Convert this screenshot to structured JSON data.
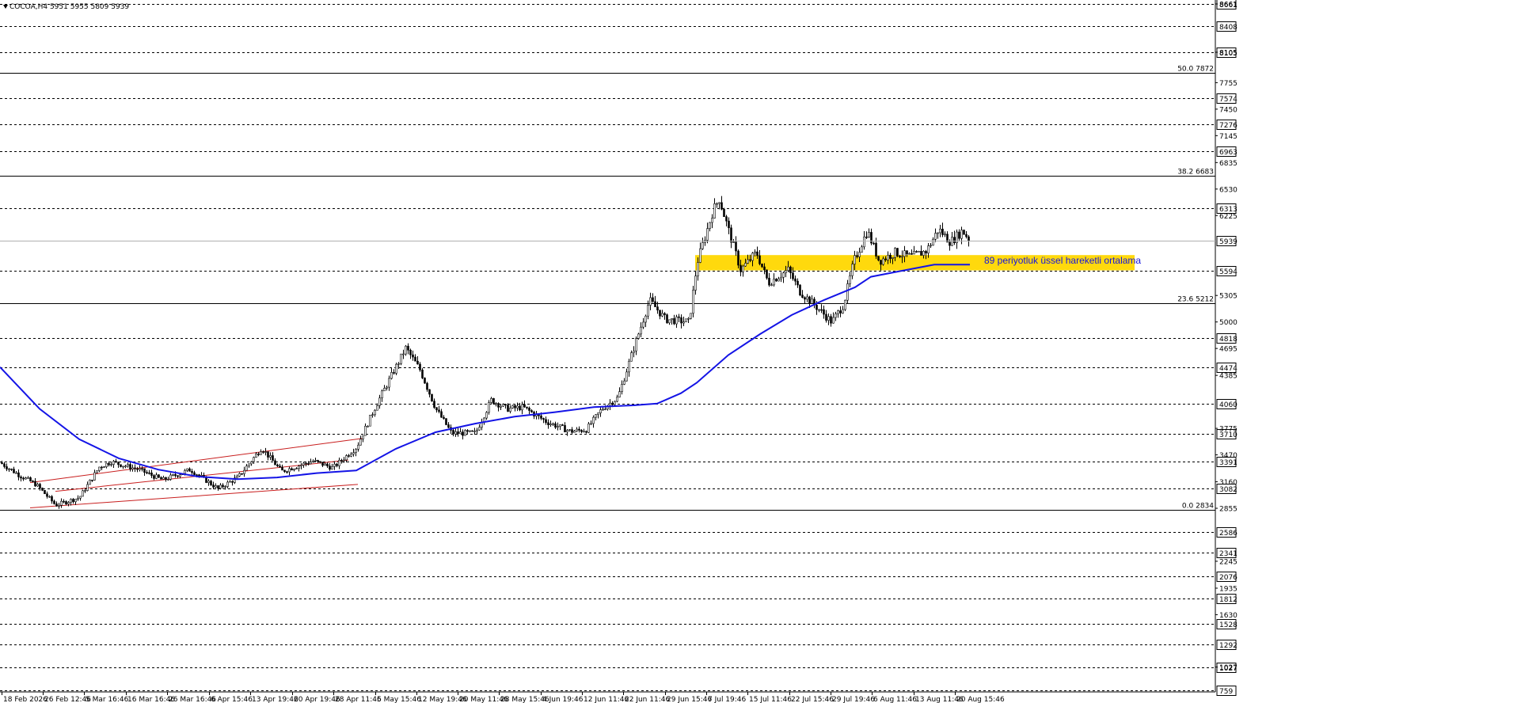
{
  "header": {
    "symbol_info": "COCOA,H4  5951 5955 5809 5939"
  },
  "annotation": "89 periyotluk üssel hareketli ortalama",
  "chart_data": {
    "type": "candlestick",
    "symbol": "COCOA",
    "timeframe": "H4",
    "ohlc": {
      "open": 5951,
      "high": 5955,
      "low": 5809,
      "close": 5939
    },
    "current_price": 5939,
    "ylim": [
      759,
      8661
    ],
    "grid": false,
    "price_axis_labels": [
      8661,
      8105,
      7755,
      7450,
      7145,
      6835,
      6530,
      6225,
      5305,
      5000,
      4695,
      4385,
      3775,
      3470,
      3160,
      2855,
      2245,
      1935,
      1630,
      1027
    ],
    "horizontal_levels": [
      8661,
      8408,
      8105,
      7574,
      7276,
      6963,
      6313,
      5594,
      4818,
      4474,
      4060,
      3710,
      3391,
      3082,
      2586,
      2341,
      2076,
      1812,
      1528,
      1292,
      1027,
      759
    ],
    "fibonacci_levels": [
      {
        "label": "50.0 7872",
        "value": 7872
      },
      {
        "label": "38.2 6683",
        "value": 6683
      },
      {
        "label": "23.6 5212",
        "value": 5212
      },
      {
        "label": "0.0 2834",
        "value": 2834
      }
    ],
    "support_zone": [
      5594,
      5770
    ],
    "x_labels": [
      "18 Feb 2026",
      "26 Feb 12:46",
      "5 Mar 16:46",
      "16 Mar 16:46",
      "26 Mar 16:46",
      "6 Apr 15:46",
      "13 Apr 19:46",
      "20 Apr 19:46",
      "28 Apr 11:46",
      "5 May 15:46",
      "12 May 19:46",
      "20 May 11:46",
      "28 May 15:46",
      "4 Jun 19:46",
      "12 Jun 11:46",
      "22 Jun 11:46",
      "29 Jun 15:46",
      "7 Jul 19:46",
      "15 Jul 11:46",
      "22 Jul 15:46",
      "29 Jul 19:46",
      "6 Aug 11:46",
      "13 Aug 11:46",
      "20 Aug 15:46"
    ],
    "price_path": [
      [
        0,
        3380
      ],
      [
        25,
        3230
      ],
      [
        45,
        3130
      ],
      [
        70,
        2890
      ],
      [
        100,
        2980
      ],
      [
        125,
        3330
      ],
      [
        140,
        3390
      ],
      [
        175,
        3300
      ],
      [
        205,
        3180
      ],
      [
        240,
        3300
      ],
      [
        275,
        3080
      ],
      [
        300,
        3210
      ],
      [
        330,
        3550
      ],
      [
        355,
        3280
      ],
      [
        395,
        3400
      ],
      [
        420,
        3320
      ],
      [
        450,
        3560
      ],
      [
        475,
        4050
      ],
      [
        495,
        4400
      ],
      [
        512,
        4700
      ],
      [
        530,
        4450
      ],
      [
        550,
        4000
      ],
      [
        570,
        3720
      ],
      [
        600,
        3720
      ],
      [
        620,
        4100
      ],
      [
        640,
        4000
      ],
      [
        660,
        4020
      ],
      [
        690,
        3850
      ],
      [
        720,
        3740
      ],
      [
        740,
        3760
      ],
      [
        760,
        4000
      ],
      [
        780,
        4130
      ],
      [
        800,
        4700
      ],
      [
        820,
        5250
      ],
      [
        840,
        5030
      ],
      [
        870,
        5000
      ],
      [
        880,
        5680
      ],
      [
        900,
        6280
      ],
      [
        908,
        6420
      ],
      [
        920,
        6050
      ],
      [
        935,
        5600
      ],
      [
        955,
        5800
      ],
      [
        970,
        5450
      ],
      [
        995,
        5600
      ],
      [
        1010,
        5350
      ],
      [
        1030,
        5180
      ],
      [
        1050,
        5000
      ],
      [
        1065,
        5200
      ],
      [
        1078,
        5700
      ],
      [
        1095,
        6050
      ],
      [
        1110,
        5700
      ],
      [
        1130,
        5800
      ],
      [
        1150,
        5750
      ],
      [
        1170,
        5820
      ],
      [
        1185,
        6070
      ],
      [
        1200,
        5920
      ],
      [
        1215,
        6050
      ],
      [
        1225,
        5939
      ]
    ],
    "series": [
      {
        "name": "89 periyotluk üssel hareketli ortalama",
        "color": "#1414e6",
        "path": [
          [
            0,
            4480
          ],
          [
            50,
            4000
          ],
          [
            100,
            3650
          ],
          [
            150,
            3430
          ],
          [
            200,
            3300
          ],
          [
            250,
            3220
          ],
          [
            300,
            3190
          ],
          [
            350,
            3210
          ],
          [
            400,
            3260
          ],
          [
            450,
            3290
          ],
          [
            500,
            3540
          ],
          [
            550,
            3730
          ],
          [
            600,
            3830
          ],
          [
            650,
            3910
          ],
          [
            700,
            3960
          ],
          [
            750,
            4020
          ],
          [
            800,
            4040
          ],
          [
            830,
            4060
          ],
          [
            860,
            4180
          ],
          [
            880,
            4300
          ],
          [
            920,
            4620
          ],
          [
            960,
            4860
          ],
          [
            1000,
            5080
          ],
          [
            1040,
            5250
          ],
          [
            1080,
            5400
          ],
          [
            1100,
            5520
          ],
          [
            1140,
            5590
          ],
          [
            1180,
            5660
          ],
          [
            1225,
            5660
          ]
        ]
      }
    ],
    "channel": {
      "color": "#c81e1e",
      "lines": [
        [
          [
            38,
            3150
          ],
          [
            458,
            3660
          ]
        ],
        [
          [
            38,
            2860
          ],
          [
            452,
            3130
          ]
        ],
        [
          [
            70,
            3050
          ],
          [
            440,
            3410
          ]
        ]
      ]
    },
    "colors": {
      "candles": "#000000",
      "ema": "#1414e6",
      "zone": "#ffd700",
      "channel": "#c81e1e",
      "current_price_line": "#b0b0b0"
    }
  }
}
